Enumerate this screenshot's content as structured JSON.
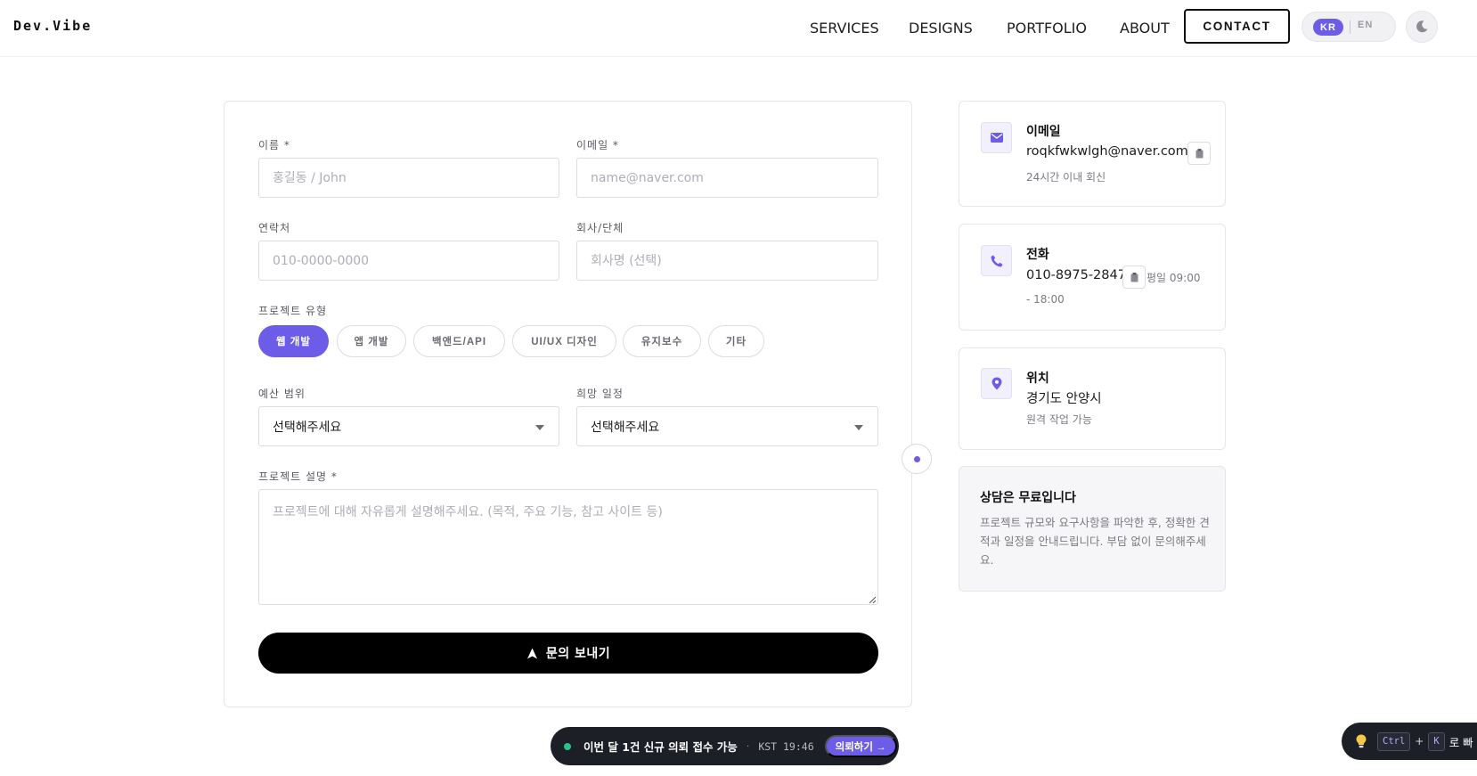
{
  "header": {
    "logo": "Dev.Vibe",
    "nav": [
      "SERVICES",
      "DESIGNS",
      "PORTFOLIO",
      "ABOUT"
    ],
    "contact": "CONTACT",
    "lang_kr": "KR",
    "lang_en": "EN"
  },
  "form": {
    "name_label": "이름 *",
    "name_placeholder": "홍길동 / John",
    "email_label": "이메일 *",
    "email_placeholder": "name@naver.com",
    "phone_label": "연락처",
    "phone_placeholder": "010-0000-0000",
    "company_label": "회사/단체",
    "company_placeholder": "회사명 (선택)",
    "type_label": "프로젝트 유형",
    "types": [
      "웹 개발",
      "앱 개발",
      "백앤드/API",
      "UI/UX 디자인",
      "유지보수",
      "기타"
    ],
    "budget_label": "예산 범위",
    "budget_value": "선택해주세요",
    "schedule_label": "희망 일정",
    "schedule_value": "선택해주세요",
    "desc_label": "프로젝트 설명 *",
    "desc_placeholder": "프로젝트에 대해 자유롭게 설명해주세요. (목적, 주요 기능, 참고 사이트 등)",
    "submit": "문의 보내기"
  },
  "info": {
    "email_title": "이메일",
    "email_value": "roqkfwkwlgh@naver.com",
    "email_sub": "24시간 이내 회신",
    "phone_title": "전화",
    "phone_value": "010-8975-2847",
    "phone_hours_a": "평일 09:00",
    "phone_hours_b": "- 18:00",
    "location_title": "위치",
    "location_value": "경기도 안양시",
    "location_sub": "원격 작업 가능"
  },
  "note": {
    "title": "상담은 무료입니다",
    "text": "프로젝트 규모와 요구사항을 파악한 후, 정확한 견적과 일정을 안내드립니다. 부담 없이 문의해주세요."
  },
  "status": {
    "text": "이번 달 1건 신규 의뢰 접수 가능",
    "sep": "·",
    "time": "KST 19:46",
    "button": "의뢰하기 →"
  },
  "shortcut": {
    "key1": "Ctrl",
    "plus": "+",
    "key2": "K",
    "text": "로 빠"
  },
  "colors": {
    "accent": "#6d5ce7",
    "dark": "#1d1f27",
    "status_green": "#22c58a"
  },
  "icons": [
    "mail-icon",
    "phone-icon",
    "location-pin-icon",
    "clipboard-icon",
    "moon-icon",
    "send-icon",
    "lightbulb-icon"
  ]
}
